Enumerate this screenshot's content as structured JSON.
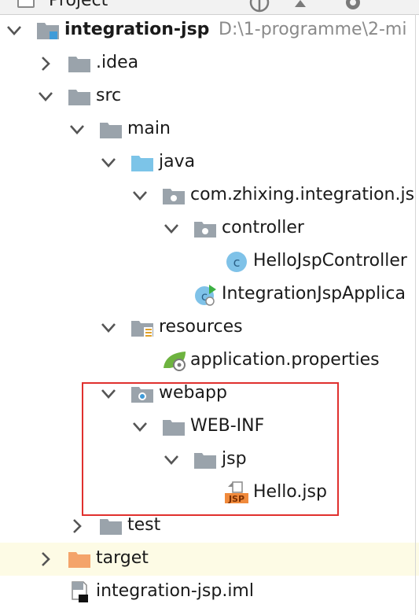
{
  "panel": {
    "title": "Project"
  },
  "colors": {
    "folder_grey": "#9aa3ab",
    "folder_blue": "#7cc4e8",
    "folder_orange": "#f4a46a",
    "class_circle": "#7fc2e8",
    "highlight_box": "#e0302e",
    "row_highlight": "#fdfbe5",
    "path_grey": "#8a8a8a"
  },
  "tree": [
    {
      "label": "integration-jsp",
      "path": "D:\\1-programme\\2-mi",
      "icon": "module-icon",
      "arrow": "expanded"
    },
    {
      "label": ".idea",
      "icon": "folder-icon",
      "arrow": "collapsed"
    },
    {
      "label": "src",
      "icon": "folder-icon",
      "arrow": "expanded"
    },
    {
      "label": "main",
      "icon": "folder-icon",
      "arrow": "expanded"
    },
    {
      "label": "java",
      "icon": "source-folder-icon",
      "arrow": "expanded"
    },
    {
      "label": "com.zhixing.integration.js",
      "icon": "package-icon",
      "arrow": "expanded"
    },
    {
      "label": "controller",
      "icon": "package-icon",
      "arrow": "expanded"
    },
    {
      "label": "HelloJspController",
      "icon": "class-icon",
      "arrow": "none"
    },
    {
      "label": "IntegrationJspApplica",
      "icon": "spring-boot-class-icon",
      "arrow": "none"
    },
    {
      "label": "resources",
      "icon": "resources-folder-icon",
      "arrow": "expanded"
    },
    {
      "label": "application.properties",
      "icon": "spring-properties-icon",
      "arrow": "none"
    },
    {
      "label": "webapp",
      "icon": "web-folder-icon",
      "arrow": "expanded"
    },
    {
      "label": "WEB-INF",
      "icon": "folder-icon",
      "arrow": "expanded"
    },
    {
      "label": "jsp",
      "icon": "folder-icon",
      "arrow": "expanded"
    },
    {
      "label": "Hello.jsp",
      "icon": "jsp-file-icon",
      "arrow": "none"
    },
    {
      "label": "test",
      "icon": "folder-icon",
      "arrow": "collapsed"
    },
    {
      "label": "target",
      "icon": "excluded-folder-icon",
      "arrow": "collapsed"
    },
    {
      "label": "integration-jsp.iml",
      "icon": "iml-file-icon",
      "arrow": "none"
    }
  ]
}
